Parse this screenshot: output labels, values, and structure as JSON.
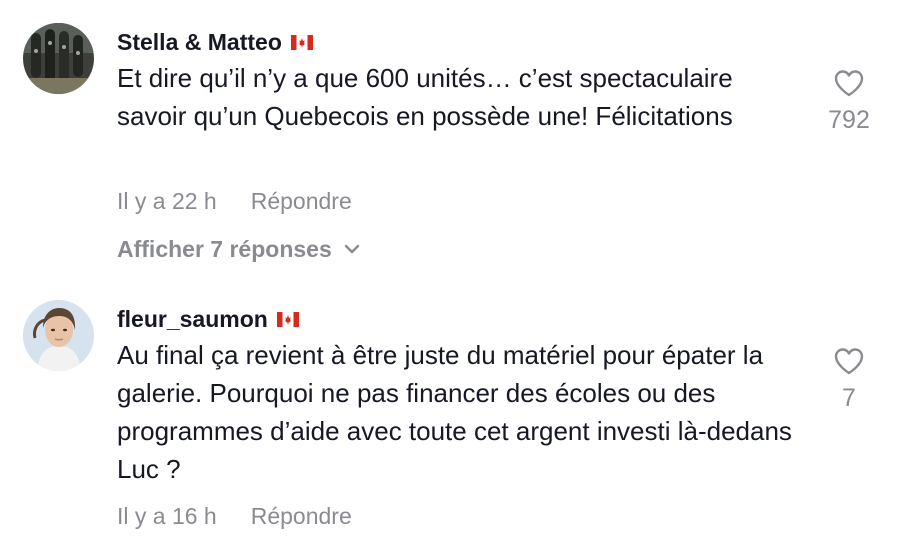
{
  "comments": [
    {
      "username": "Stella & Matteo",
      "flag": "canada-flag-icon",
      "text": "Et dire qu’il n’y a que 600 unités… c’est spectaculaire savoir qu’un Quebecois en possède une! Félicitations",
      "time": "Il y a 22 h",
      "reply_label": "Répondre",
      "likes": "792",
      "view_replies_label": "Afficher 7 réponses"
    },
    {
      "username": "fleur_saumon",
      "flag": "canada-flag-icon",
      "text": "Au final ça revient à être juste du matériel pour épater la galerie. Pourquoi ne pas financer des écoles ou des programmes d’aide avec toute cet argent investi là-dedans Luc ?",
      "time": "Il y a 16 h",
      "reply_label": "Répondre",
      "likes": "7"
    }
  ],
  "colors": {
    "primary_text": "#161823",
    "secondary_text": "#8a8b91",
    "background": "#ffffff",
    "flag_red": "#d52b1e"
  }
}
